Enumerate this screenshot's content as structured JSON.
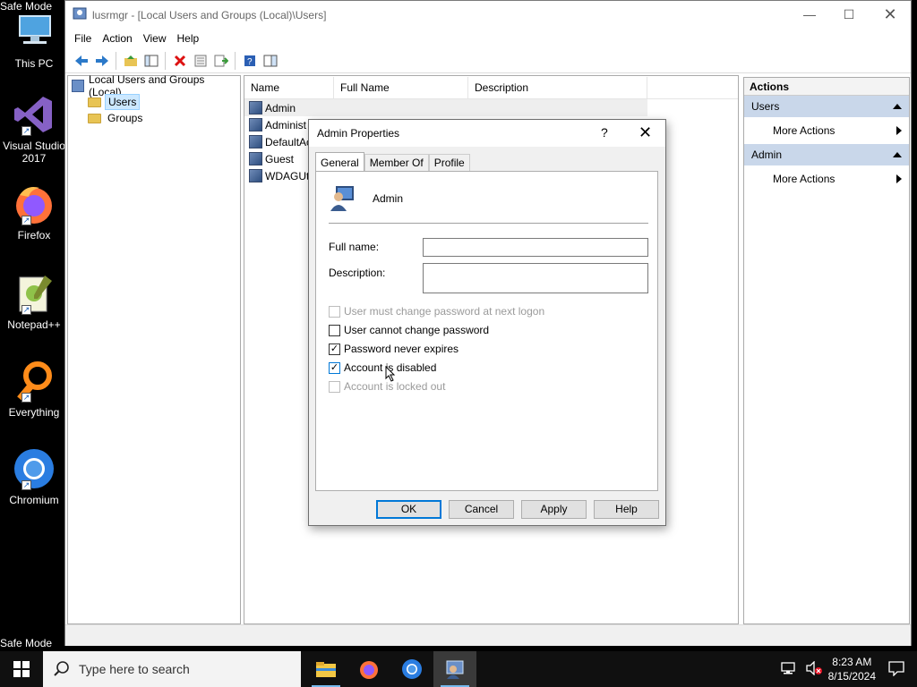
{
  "desktop": {
    "safe_mode_top": "Safe Mode",
    "safe_mode_bottom": "Safe Mode",
    "icons": [
      {
        "label": "This PC"
      },
      {
        "label": "Visual Studio 2017"
      },
      {
        "label": "Firefox"
      },
      {
        "label": "Notepad++"
      },
      {
        "label": "Everything"
      },
      {
        "label": "Chromium"
      }
    ]
  },
  "window": {
    "title": "lusrmgr - [Local Users and Groups (Local)\\Users]",
    "menu": [
      "File",
      "Action",
      "View",
      "Help"
    ],
    "tree": {
      "root": "Local Users and Groups (Local)",
      "items": [
        "Users",
        "Groups"
      ],
      "selected": "Users"
    },
    "list": {
      "columns": [
        "Name",
        "Full Name",
        "Description"
      ],
      "rows": [
        "Admin",
        "Administ",
        "DefaultAc",
        "Guest",
        "WDAGUti"
      ]
    },
    "actions": {
      "header": "Actions",
      "sections": [
        {
          "title": "Users",
          "item": "More Actions"
        },
        {
          "title": "Admin",
          "item": "More Actions"
        }
      ]
    }
  },
  "dialog": {
    "title": "Admin Properties",
    "help_glyph": "?",
    "tabs": [
      "General",
      "Member Of",
      "Profile"
    ],
    "active_tab": "General",
    "username": "Admin",
    "full_name_label": "Full name:",
    "full_name_value": "",
    "description_label": "Description:",
    "description_value": "",
    "checkboxes": [
      {
        "label": "User must change password at next logon",
        "checked": false,
        "enabled": false
      },
      {
        "label": "User cannot change password",
        "checked": false,
        "enabled": true
      },
      {
        "label": "Password never expires",
        "checked": true,
        "enabled": true
      },
      {
        "label": "Account is disabled",
        "checked": true,
        "enabled": true
      },
      {
        "label": "Account is locked out",
        "checked": false,
        "enabled": false
      }
    ],
    "buttons": {
      "ok": "OK",
      "cancel": "Cancel",
      "apply": "Apply",
      "help": "Help"
    }
  },
  "taskbar": {
    "search_placeholder": "Type here to search",
    "time": "8:23 AM",
    "date": "8/15/2024"
  },
  "colors": {
    "accent": "#0078d7",
    "actions_section_bg": "#c9d7ea",
    "tree_selection": "#cce8ff"
  }
}
